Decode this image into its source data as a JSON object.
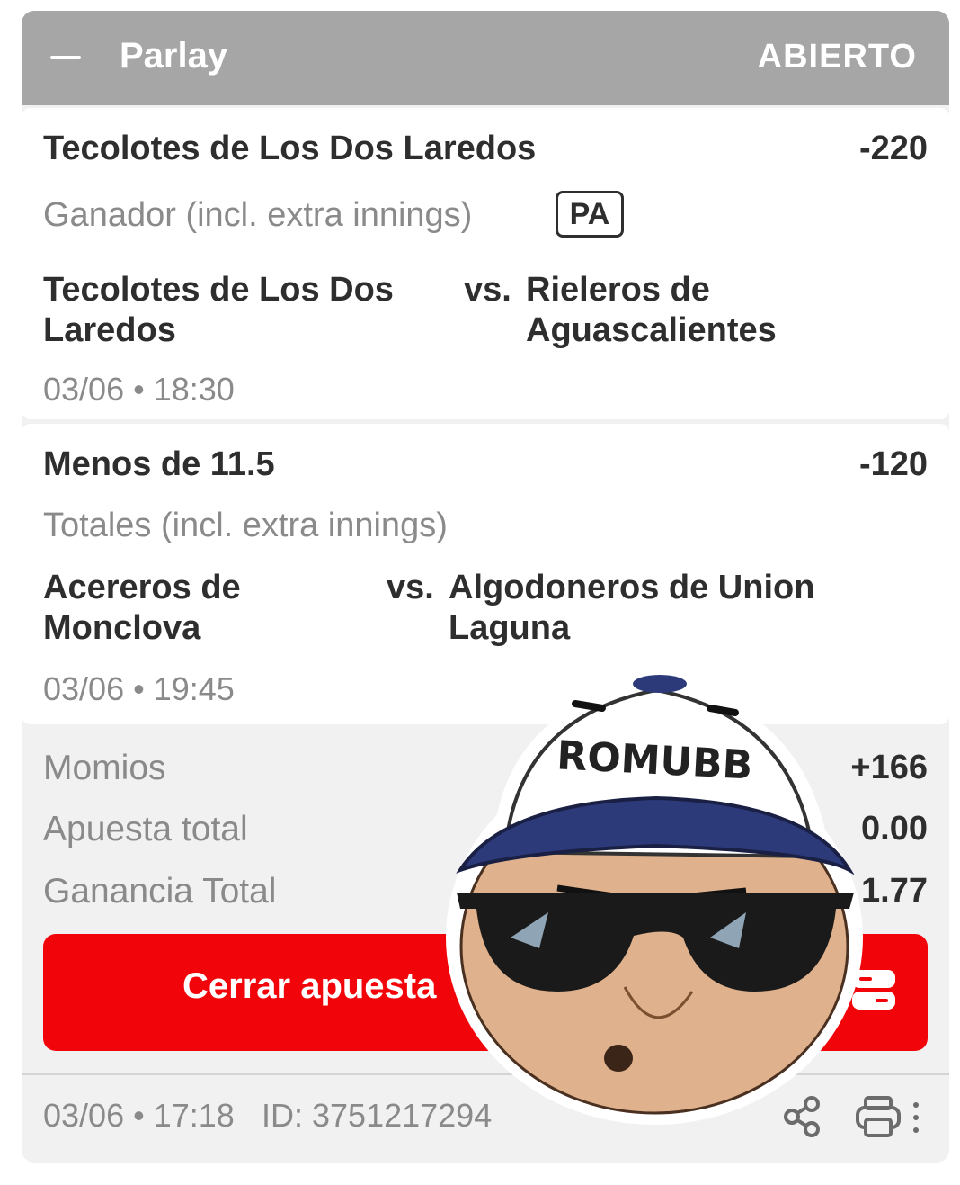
{
  "header": {
    "title": "Parlay",
    "status": "ABIERTO"
  },
  "legs": [
    {
      "selection": "Tecolotes de Los Dos Laredos",
      "odds": "-220",
      "market": "Ganador (incl. extra innings)",
      "badge": "PA",
      "home_line1": "Tecolotes de Los Dos",
      "home_line2": "Laredos",
      "vs": "vs.",
      "away_line1": "Rieleros de",
      "away_line2": "Aguascalientes",
      "datetime": "03/06 • 18:30"
    },
    {
      "selection": "Menos de 11.5",
      "odds": "-120",
      "market": "Totales (incl. extra innings)",
      "home_line1": "Acereros de",
      "home_line2": "Monclova",
      "vs": "vs.",
      "away_line1": "Algodoneros de Union",
      "away_line2": "Laguna",
      "datetime": "03/06 • 19:45"
    }
  ],
  "summary": {
    "odds_label": "Momios",
    "odds_value": "+166",
    "stake_label": "Apuesta total",
    "stake_value": "0.00",
    "win_label": "Ganancia Total",
    "win_value": "1.77"
  },
  "cashout": {
    "label": "Cerrar apuesta"
  },
  "footer": {
    "date": "03/06 • 17:18",
    "id": "ID: 3751217294"
  },
  "sticker": {
    "cap_text": "ROMUBB"
  },
  "colors": {
    "header_bg": "#a6a6a6",
    "cashout_bg": "#f2050a",
    "card_bg": "#ffffff",
    "ticket_bg": "#f1f1f1"
  },
  "icons": [
    "collapse-icon",
    "cashout-icon",
    "share-icon",
    "print-icon",
    "more-icon"
  ]
}
